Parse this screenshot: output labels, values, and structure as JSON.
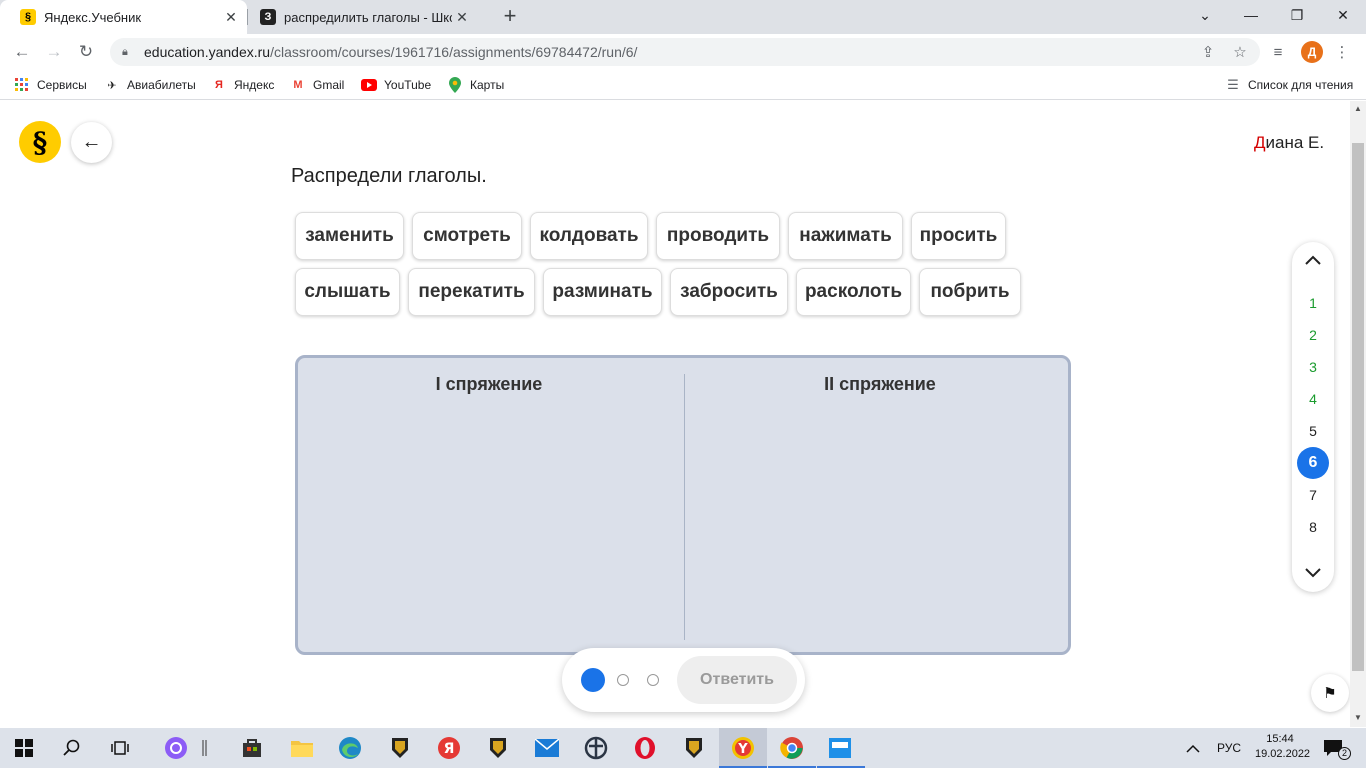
{
  "browser": {
    "tabs": [
      {
        "title": "Яндекс.Учебник",
        "favicon": "§",
        "active": true
      },
      {
        "title": "распредилить глаголы - Школьн",
        "favicon": "З",
        "active": false
      }
    ],
    "url_host": "education.yandex.ru",
    "url_path": "/classroom/courses/1961716/assignments/69784472/run/6/",
    "profile_initial": "Д",
    "bookmarks": [
      {
        "label": "Сервисы",
        "icon": "apps-grid-icon"
      },
      {
        "label": "Авиабилеты",
        "icon": "airplane-icon"
      },
      {
        "label": "Яндекс",
        "icon": "yandex-icon"
      },
      {
        "label": "Gmail",
        "icon": "gmail-icon"
      },
      {
        "label": "YouTube",
        "icon": "youtube-icon"
      },
      {
        "label": "Карты",
        "icon": "maps-pin-icon"
      }
    ],
    "reading_list": "Список для чтения"
  },
  "page": {
    "user_first_letter": "Д",
    "user_rest": "иана Е.",
    "task_title": "Распредели глаголы.",
    "words_row1": [
      "заменить",
      "смотреть",
      "колдовать",
      "проводить",
      "нажимать",
      "просить"
    ],
    "words_row2": [
      "слышать",
      "перекатить",
      "разминать",
      "забросить",
      "расколоть",
      "побрить"
    ],
    "column1_title": "I спряжение",
    "column2_title": "II спряжение",
    "answer_label": "Ответить",
    "progress_dots": {
      "total": 3,
      "current": 1
    },
    "question_nav": {
      "items": [
        "1",
        "2",
        "3",
        "4",
        "5",
        "6",
        "7",
        "8"
      ],
      "completed": [
        "1",
        "2",
        "3",
        "4"
      ],
      "current": "6"
    }
  },
  "taskbar": {
    "language": "РУС",
    "time": "15:44",
    "date": "19.02.2022",
    "notifications": "2"
  },
  "colors": {
    "accent_blue": "#1a73e8",
    "done_green": "#1a9b2e",
    "board_bg": "#dbe0ea",
    "logo_yellow": "#ffcc00",
    "user_red": "#d40000"
  }
}
